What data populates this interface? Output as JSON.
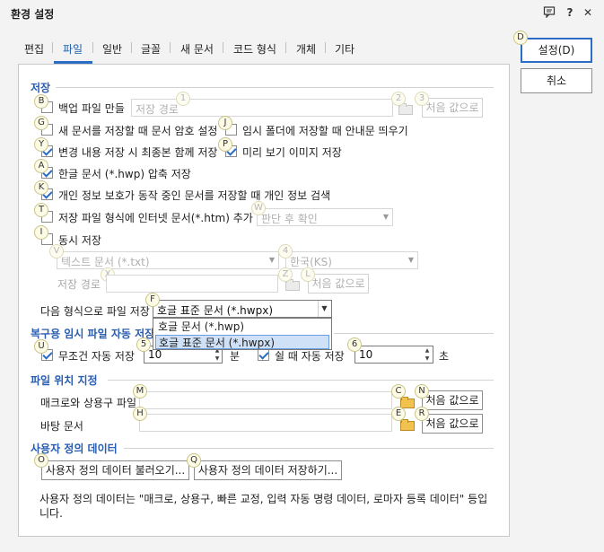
{
  "window": {
    "title": "환경 설정"
  },
  "titlebar_icons": {
    "comment": "comment-icon",
    "help": "?",
    "close": "✕"
  },
  "tabs": [
    {
      "label": "편집"
    },
    {
      "label": "파일"
    },
    {
      "label": "일반"
    },
    {
      "label": "글꼴"
    },
    {
      "label": "새 문서"
    },
    {
      "label": "코드 형식"
    },
    {
      "label": "개체"
    },
    {
      "label": "기타"
    }
  ],
  "active_tab": "파일",
  "side_buttons": {
    "ok": "설정(D)",
    "ok_hint": "D",
    "cancel": "취소"
  },
  "sections": {
    "save": "저장",
    "autosave": "복구용 임시 파일 자동 저장",
    "location": "파일 위치 지정",
    "userdata": "사용자 정의 데이터"
  },
  "save": {
    "backup": {
      "label": "백업 파일 만들",
      "hint": "B",
      "checked": false
    },
    "backup_path": {
      "placeholder": "저장 경로",
      "hint": "1"
    },
    "backup_folder_hint": "2",
    "backup_default": {
      "label": "처음 값으로",
      "hint": "3"
    },
    "encrypt": {
      "label": "새 문서를 저장할 때 문서 암호 설정",
      "hint": "G",
      "checked": false
    },
    "temp_notice": {
      "label": "임시 폴더에 저장할 때 안내문 띄우기",
      "hint": "J",
      "checked": false
    },
    "final_save": {
      "label": "변경 내용 저장 시 최종본 함께 저장",
      "hint": "Y",
      "checked": true
    },
    "preview": {
      "label": "미리 보기 이미지 저장",
      "hint": "P",
      "checked": true
    },
    "compress": {
      "label": "한글 문서 (*.hwp) 압축 저장",
      "hint": "A",
      "checked": true
    },
    "privacy": {
      "label": "개인 정보 보호가 동작 중인 문서를 저장할 때 개인 정보 검색",
      "hint": "K",
      "checked": true
    },
    "internet": {
      "label": "저장 파일 형식에 인터넷 문서(*.htm) 추가",
      "hint": "T",
      "checked": false
    },
    "internet_combo": {
      "value": "판단 후 확인",
      "hint": "W"
    },
    "simul": {
      "label": "동시 저장",
      "hint": "I",
      "checked": false
    },
    "simul_format": {
      "value": "텍스트 문서 (*.txt)",
      "hint": "V"
    },
    "simul_code": {
      "value": "한국(KS)",
      "hint": "4"
    },
    "simul_path": {
      "label": "저장 경로",
      "hint": "X"
    },
    "simul_folder_hint": "Z",
    "simul_default": {
      "label": "처음 값으로",
      "hint": "L"
    },
    "next_format": {
      "label": "다음 형식으로 파일 저장",
      "hint": "F",
      "value": "호글 표준 문서 (*.hwpx)"
    },
    "format_options": [
      "호글 문서 (*.hwp)",
      "호글 표준 문서 (*.hwpx)"
    ]
  },
  "autosave": {
    "unconditional": {
      "label": "무조건 자동 저장",
      "hint": "U",
      "checked": true,
      "value": "10",
      "value_hint": "5",
      "unit": "분"
    },
    "idle": {
      "label": "쉴 때 자동 저장",
      "checked": true,
      "value": "10",
      "value_hint": "6",
      "unit": "초"
    }
  },
  "location": {
    "macro": {
      "label": "매크로와 상용구 파일",
      "hint": "M",
      "folder_hint": "C",
      "default": "처음 값으로",
      "default_hint": "N"
    },
    "background": {
      "label": "바탕 문서",
      "hint": "H",
      "folder_hint": "E",
      "default": "처음 값으로",
      "default_hint": "R"
    }
  },
  "userdata": {
    "load": {
      "label": "사용자 정의 데이터 불러오기...",
      "hint": "O"
    },
    "save": {
      "label": "사용자 정의 데이터 저장하기...",
      "hint": "Q"
    },
    "note": "사용자 정의 데이터는 \"매크로, 상용구, 빠른 교정, 입력 자동 명령 데이터, 로마자 등록 데이터\" 등입니다."
  }
}
